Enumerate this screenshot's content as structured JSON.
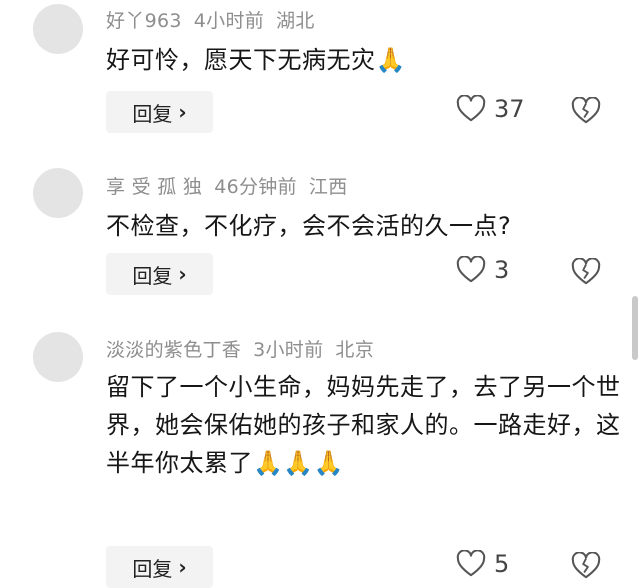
{
  "comments": [
    {
      "username": "好丫963",
      "time": "4小时前",
      "location": "湖北",
      "text": "好可怜，愿天下无病无灾",
      "emoji": "🙏",
      "reply_label": "回复",
      "likes": "37"
    },
    {
      "username": "享 受 孤 独",
      "time": "46分钟前",
      "location": "江西",
      "text": "不检查，不化疗，会不会活的久一点?",
      "reply_label": "回复",
      "likes": "3"
    },
    {
      "username": "淡淡的紫色丁香",
      "time": "3小时前",
      "location": "北京",
      "text": "留下了一个小生命，妈妈先走了，去了另一个世界，她会保佑她的孩子和家人的。一路走好，这半年你太累了",
      "emoji": "🙏🙏🙏",
      "reply_label": "回复",
      "likes": "5"
    }
  ],
  "icons": {
    "reply_chevron": "›",
    "like": "heart-outline-icon",
    "dislike": "broken-heart-icon"
  }
}
